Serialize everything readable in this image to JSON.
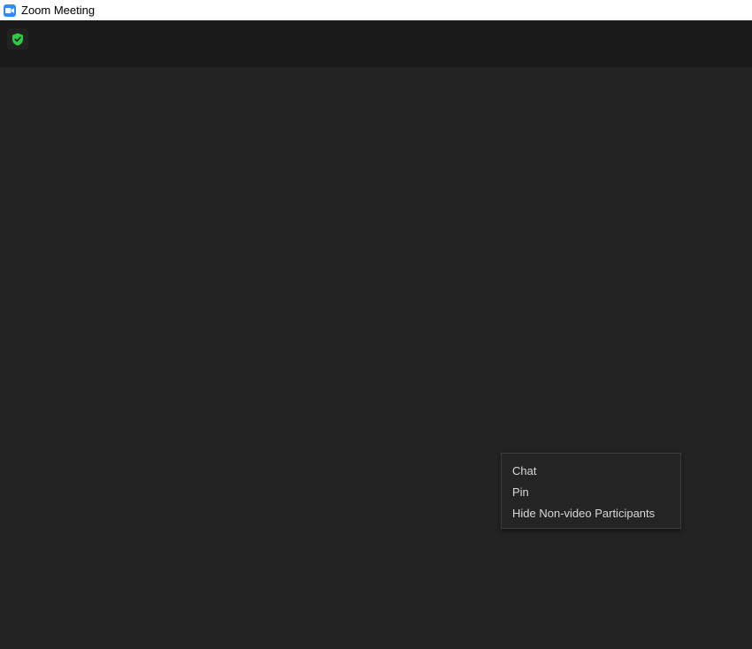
{
  "window": {
    "title": "Zoom Meeting",
    "app_icon": "zoom-camera-icon"
  },
  "topbar": {
    "security_icon": "shield-check-icon",
    "security_color": "#2ecc40"
  },
  "context_menu": {
    "items": [
      {
        "label": "Chat"
      },
      {
        "label": "Pin"
      },
      {
        "label": "Hide Non-video Participants"
      }
    ]
  },
  "colors": {
    "background": "#232323",
    "topbar": "#1a1a1a",
    "accent": "#2d8cff"
  }
}
